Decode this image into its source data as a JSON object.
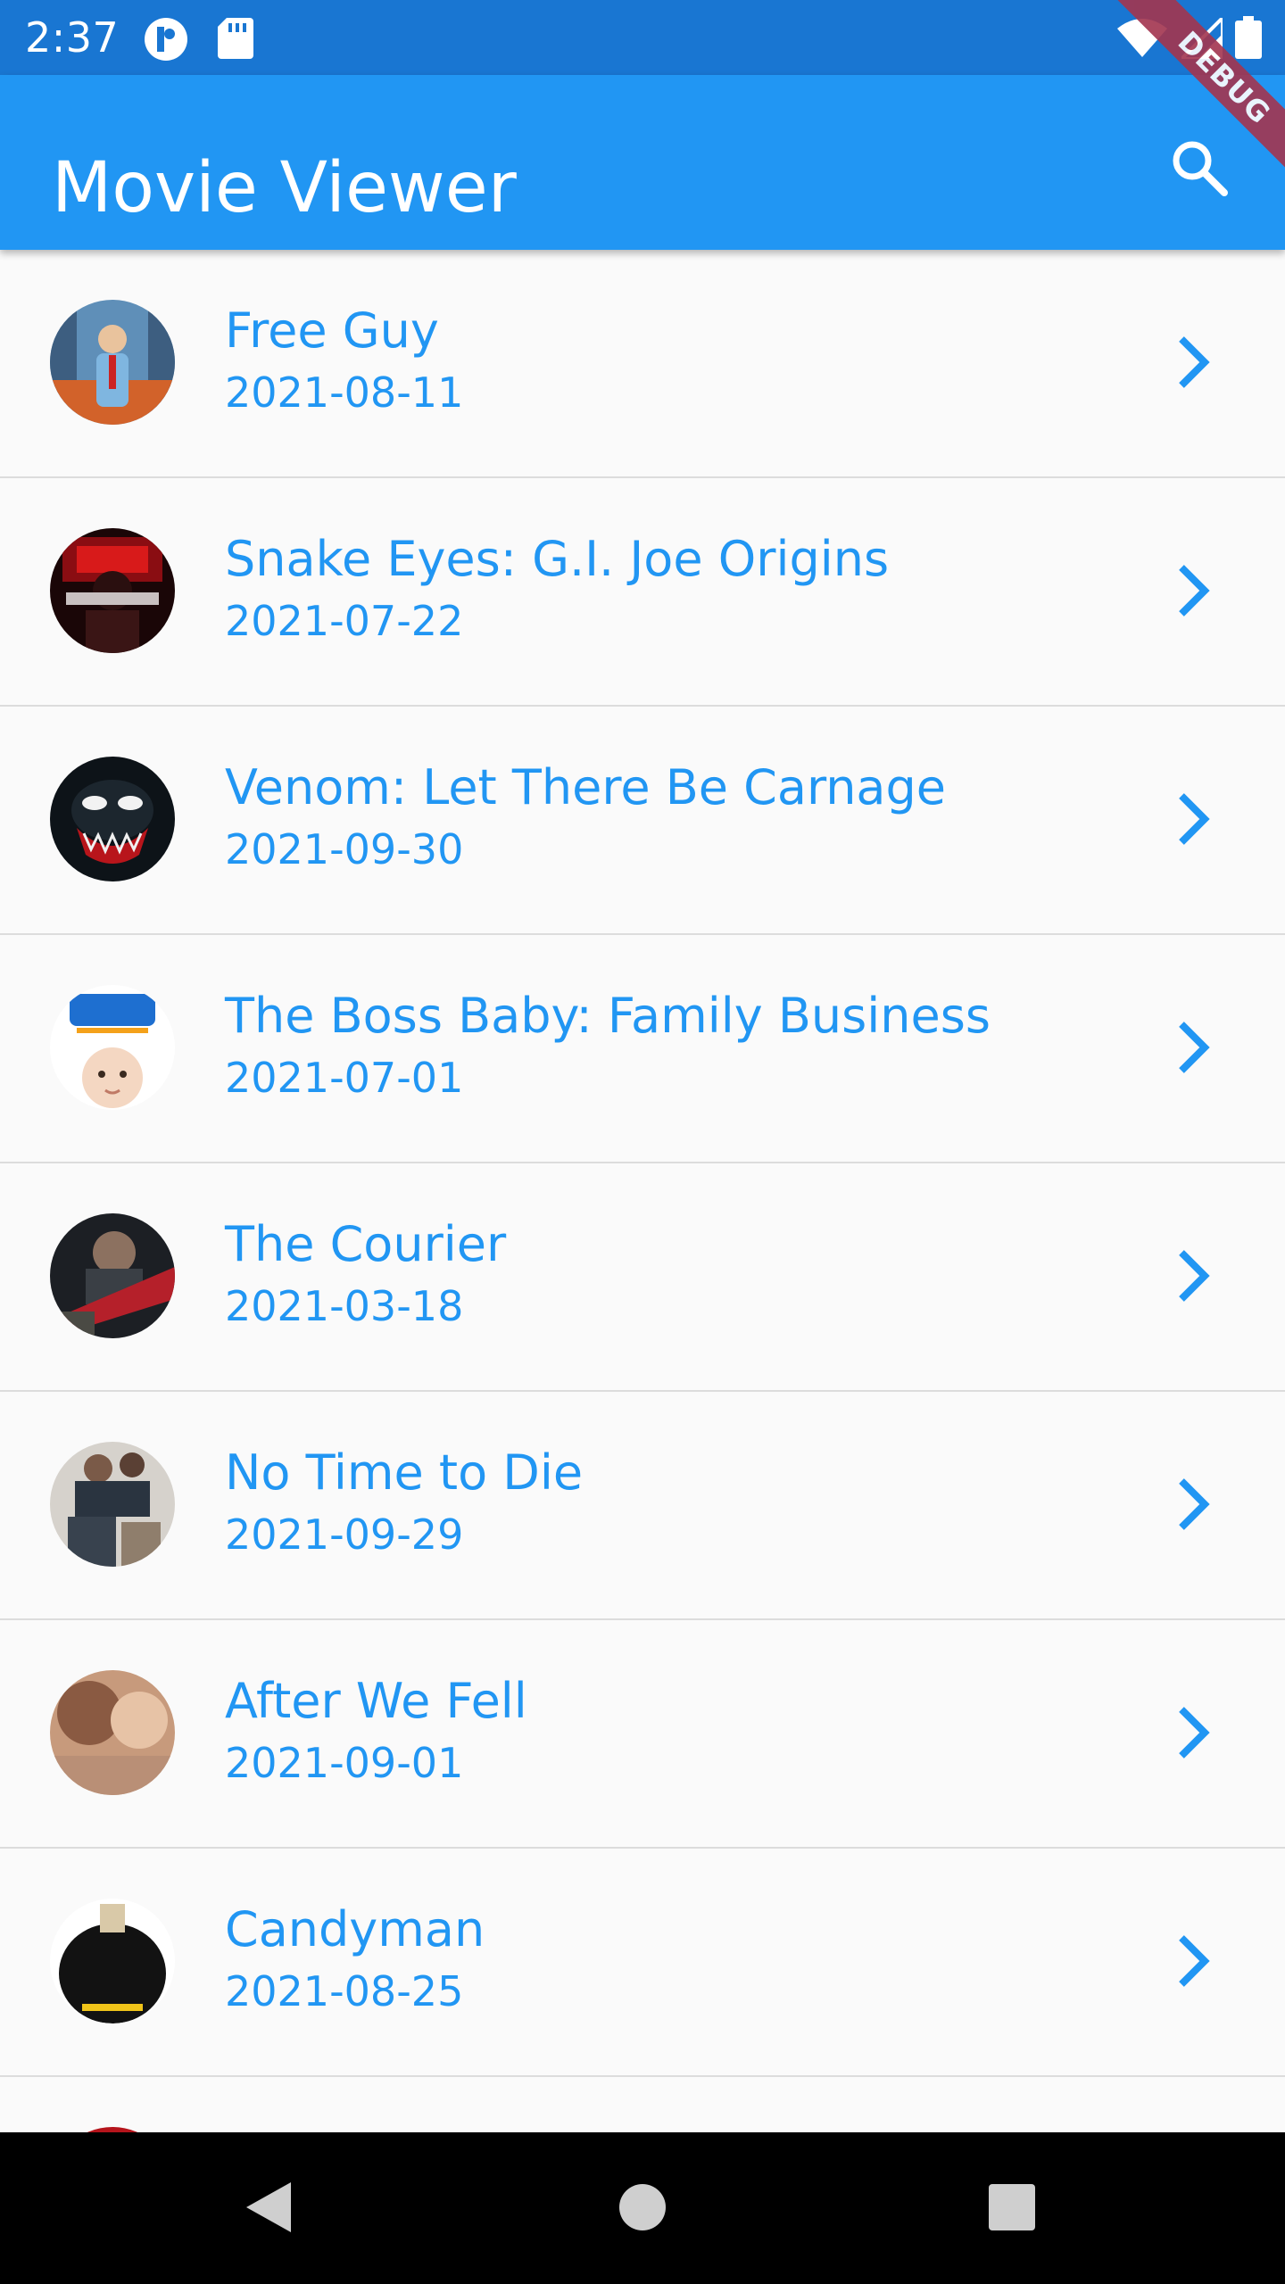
{
  "status_bar": {
    "time": "2:37"
  },
  "debug_banner": {
    "label": "DEBUG"
  },
  "app_bar": {
    "title": "Movie Viewer",
    "search_icon": "search-icon"
  },
  "movies": [
    {
      "title": "Free Guy",
      "date": "2021-08-11"
    },
    {
      "title": "Snake Eyes: G.I. Joe Origins",
      "date": "2021-07-22"
    },
    {
      "title": "Venom: Let There Be Carnage",
      "date": "2021-09-30"
    },
    {
      "title": "The Boss Baby: Family Business",
      "date": "2021-07-01"
    },
    {
      "title": "The Courier",
      "date": "2021-03-18"
    },
    {
      "title": "No Time to Die",
      "date": "2021-09-29"
    },
    {
      "title": "After We Fell",
      "date": "2021-09-01"
    },
    {
      "title": "Candyman",
      "date": "2021-08-25"
    }
  ],
  "colors": {
    "status_bar": "#1976D2",
    "app_bar": "#2196F3",
    "accent_text": "#2196F3",
    "background": "#fafafa",
    "divider": "#dcdcdc",
    "debug_ribbon": "#a3354f"
  }
}
